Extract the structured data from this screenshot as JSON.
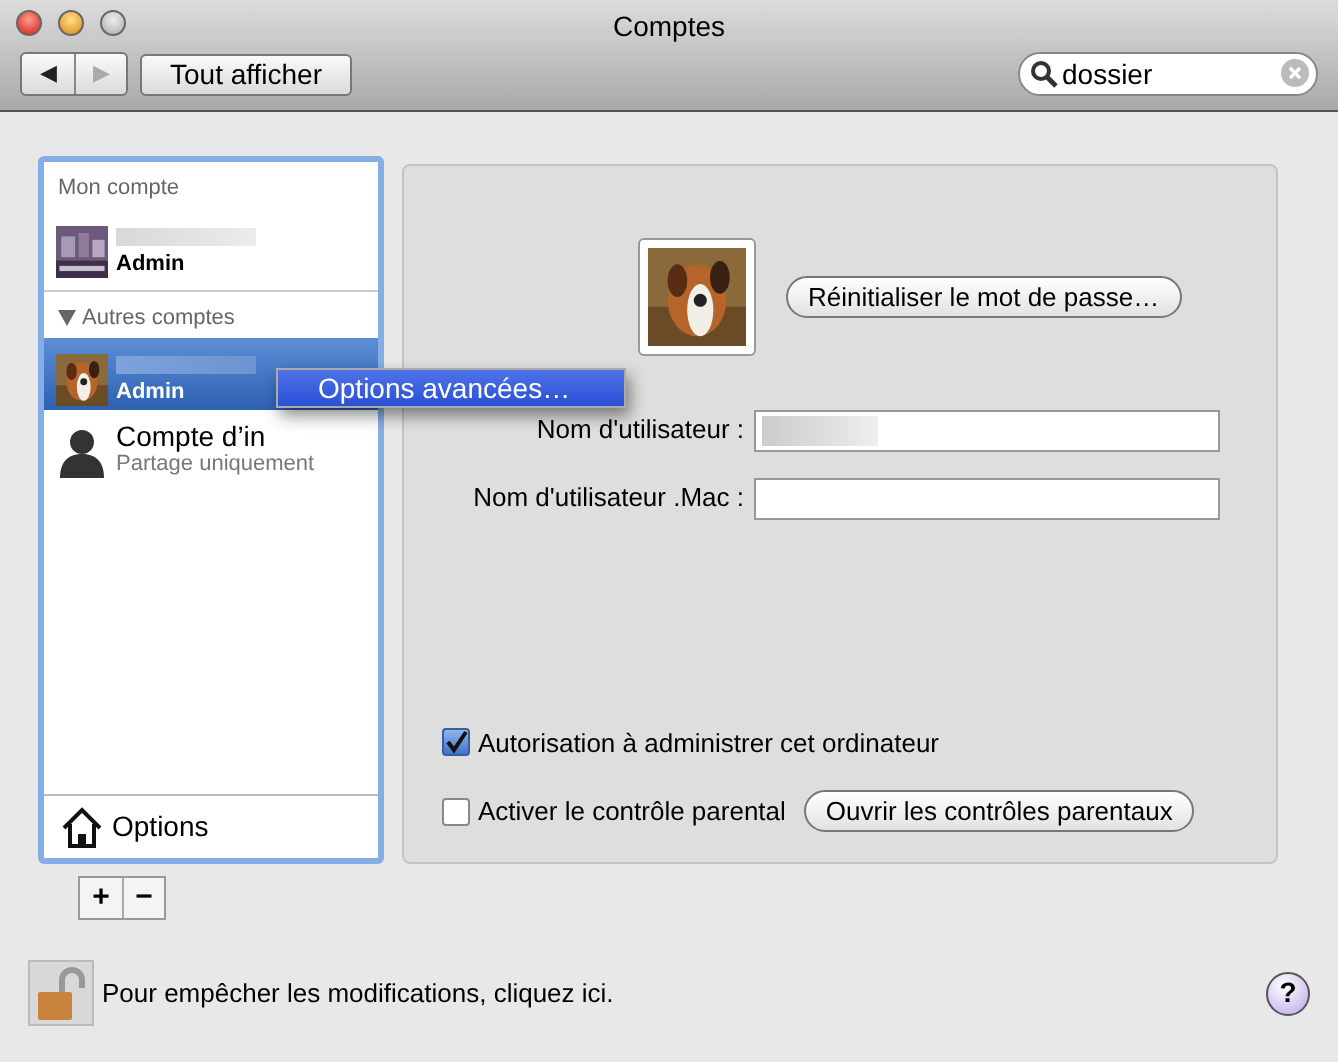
{
  "window": {
    "title": "Comptes"
  },
  "toolbar": {
    "nav_buttons": [
      {
        "glyph": "◀",
        "disabled": false
      },
      {
        "glyph": "▶",
        "disabled": true
      }
    ],
    "show_all_button": "Tout afficher",
    "search": {
      "value": "dossier"
    }
  },
  "accounts": {
    "sections": [
      {
        "heading": "Mon compte",
        "items": [
          {
            "kind": "user",
            "role": "Admin",
            "selected": false
          }
        ]
      },
      {
        "heading": "Autres comptes",
        "expanded": true,
        "items": [
          {
            "kind": "user",
            "role": "Admin",
            "selected": true
          },
          {
            "kind": "guest",
            "name": "Compte d’in",
            "role": "Partage uniquement",
            "selected": false
          }
        ]
      }
    ],
    "options_label": "Options"
  },
  "context_menu": {
    "items": [
      {
        "label": "Options avancées…",
        "selected": true
      }
    ]
  },
  "details": {
    "reset_password_button": "Réinitialiser le mot de passe…",
    "fields": [
      {
        "label": "Nom d'utilisateur :",
        "redacted": true
      },
      {
        "label": "Nom d'utilisateur .Mac :",
        "redacted": false
      }
    ],
    "checkboxes": [
      {
        "label": "Autorisation à administrer cet ordinateur",
        "checked": true
      },
      {
        "label": "Activer le contrôle parental",
        "checked": false
      }
    ],
    "parental_button": "Ouvrir les contrôles parentaux"
  },
  "list_buttons": [
    "+",
    "−"
  ],
  "lock": {
    "text": "Pour empêcher les modifications, cliquez ici."
  },
  "help_button": "?"
}
